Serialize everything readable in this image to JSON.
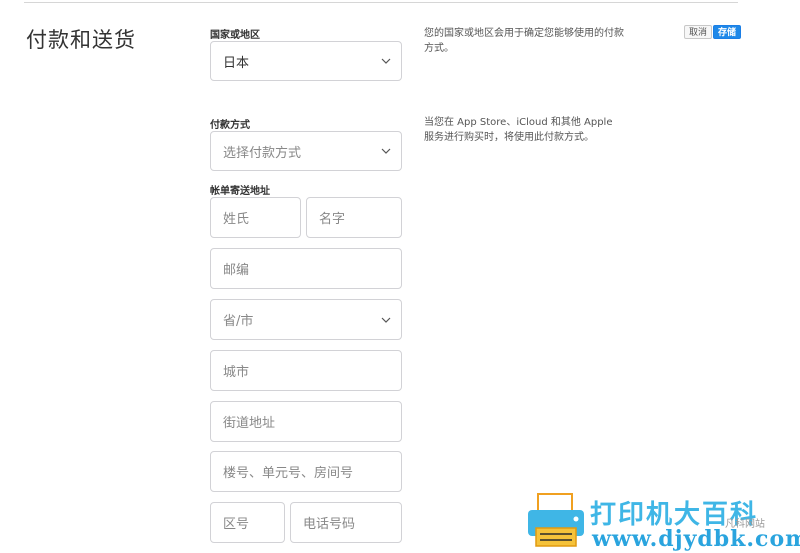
{
  "section": {
    "title": "付款和送货"
  },
  "actions": {
    "cancel_label": "取消",
    "save_label": "存储",
    "save_color": "#1f88e8"
  },
  "country": {
    "label": "国家或地区",
    "value": "日本",
    "help": "您的国家或地区会用于确定您能够使用的付款方式。"
  },
  "payment": {
    "label": "付款方式",
    "placeholder": "选择付款方式",
    "help": "当您在 App Store、iCloud 和其他 Apple 服务进行购买时，将使用此付款方式。"
  },
  "billing": {
    "label": "帐单寄送地址",
    "last_name": "姓氏",
    "first_name": "名字",
    "postal_code": "邮编",
    "prefecture": "省/市",
    "city": "城市",
    "street": "街道地址",
    "building": "楼号、单元号、房间号",
    "area_code": "区号",
    "phone": "电话号码"
  },
  "watermark": {
    "title": "打印机大百科",
    "url": "www.djydbk.com",
    "sub": "凡科网站"
  }
}
